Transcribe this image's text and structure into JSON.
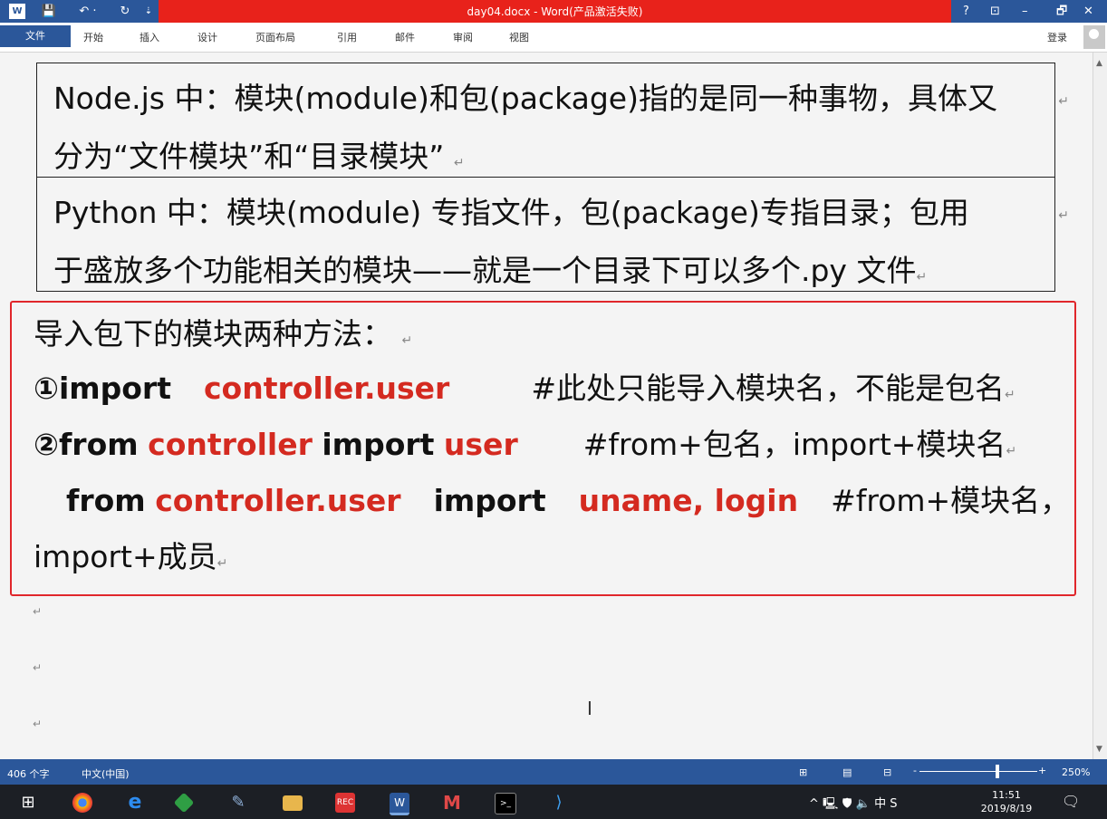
{
  "window": {
    "title": "day04.docx - Word(产品激活失败)",
    "quick_access": [
      "W",
      "💾",
      "↶ ·",
      "↻",
      "⇣"
    ],
    "help": "?",
    "ribbon_display": "⊡",
    "minimize": "–",
    "restore": "🗗",
    "close": "✕"
  },
  "ribbon": {
    "file_tab": "文件",
    "tabs": [
      "开始",
      "插入",
      "设计",
      "页面布局",
      "引用",
      "邮件",
      "审阅",
      "视图"
    ],
    "login": "登录"
  },
  "document": {
    "box1": {
      "line1": "Node.js 中：模块(module)和包(package)指的是同一种事物，具体又",
      "line2": "分为“文件模块”和“目录模块”"
    },
    "box2": {
      "line1": "Python 中：模块(module) 专指文件，包(package)专指目录；包用",
      "line2": "于盛放多个功能相关的模块——就是一个目录下可以多个.py 文件"
    },
    "redbox": {
      "heading": "导入包下的模块两种方法：",
      "l2_num": "①import",
      "l2_mod": "controller.user",
      "l2_comment": "#此处只能导入模块名，不能是包名",
      "l3_num": "②from",
      "l3_pkg": "controller",
      "l3_import": "import",
      "l3_mod": "user",
      "l3_comment": "#from+包名，import+模块名",
      "l4_from": "from",
      "l4_mod": "controller.user",
      "l4_import": "import",
      "l4_members": "uname, login",
      "l4_comment": "#from+模块名，",
      "l5": "import+成员"
    },
    "para_mark": "↵",
    "text_cursor": "I"
  },
  "statusbar": {
    "word_count": "406 个字",
    "language": "中文(中国)",
    "zoom": "250%",
    "zoom_level": 0.6,
    "view_icons": [
      "⊞",
      "▤",
      "⊟"
    ],
    "zoom_minus": "-",
    "zoom_plus": "+"
  },
  "taskbar": {
    "apps": [
      "windows-start",
      "chrome",
      "ie",
      "app-green",
      "app-paint",
      "file-explorer",
      "recorder",
      "word",
      "app-m",
      "terminal",
      "vscode"
    ],
    "tray": "^ 🖳 🛡 🔈 中 S",
    "time": "11:51",
    "date": "2019/8/19",
    "notif": "🗨"
  }
}
